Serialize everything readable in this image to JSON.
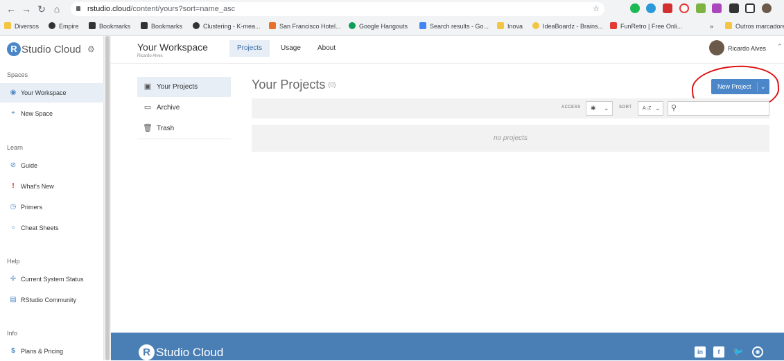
{
  "browser": {
    "url_host": "rstudio.cloud",
    "url_path": "/content/yours?sort=name_asc",
    "bookmarks": [
      {
        "label": "Diversos",
        "color": "#f4c542"
      },
      {
        "label": "Empire",
        "color": "#333333"
      },
      {
        "label": "Bookmarks",
        "color": "#333333"
      },
      {
        "label": "Bookmarks",
        "color": "#333333"
      },
      {
        "label": "Clustering - K-mea...",
        "color": "#333333"
      },
      {
        "label": "San Francisco Hotel...",
        "color": "#e8702a"
      },
      {
        "label": "Google Hangouts",
        "color": "#0f9d58"
      },
      {
        "label": "Search results - Go...",
        "color": "#4285f4"
      },
      {
        "label": "Inova",
        "color": "#f4c542"
      },
      {
        "label": "IdeaBoardz - Brains...",
        "color": "#f4c542"
      },
      {
        "label": "FunRetro | Free Onli...",
        "color": "#e53935"
      },
      {
        "label": "»",
        "color": ""
      },
      {
        "label": "Outros marcadores",
        "color": "#f4c542"
      }
    ]
  },
  "sidebar": {
    "logo_text": "Studio Cloud",
    "logo_letter": "R",
    "sections": {
      "spaces": "Spaces",
      "learn": "Learn",
      "help": "Help",
      "info": "Info"
    },
    "spaces_items": [
      {
        "label": "Your Workspace",
        "icon": "workspace-icon"
      },
      {
        "label": "New Space",
        "icon": "plus-icon"
      }
    ],
    "learn_items": [
      {
        "label": "Guide",
        "icon": "compass-icon"
      },
      {
        "label": "What's New",
        "icon": "exclamation-icon"
      },
      {
        "label": "Primers",
        "icon": "stopwatch-icon"
      },
      {
        "label": "Cheat Sheets",
        "icon": "circle-icon"
      }
    ],
    "help_items": [
      {
        "label": "Current System Status",
        "icon": "status-icon"
      },
      {
        "label": "RStudio Community",
        "icon": "chat-icon"
      }
    ],
    "info_items": [
      {
        "label": "Plans & Pricing",
        "icon": "dollar-icon"
      }
    ]
  },
  "header": {
    "title": "Your Workspace",
    "subtitle": "Ricardo Alves",
    "tabs": [
      "Projects",
      "Usage",
      "About"
    ],
    "user_name": "Ricardo Alves"
  },
  "content_nav": [
    {
      "label": "Your Projects",
      "icon": "projects-icon"
    },
    {
      "label": "Archive",
      "icon": "archive-icon"
    },
    {
      "label": "Trash",
      "icon": "trash-icon"
    }
  ],
  "projects": {
    "title": "Your Projects",
    "count": "(0)",
    "new_button": "New Project",
    "access_label": "ACCESS",
    "access_value": "✱",
    "sort_label": "SORT",
    "sort_value": "A↓Z",
    "empty_text": "no projects"
  },
  "footer": {
    "logo_text": "Studio Cloud",
    "logo_letter": "R",
    "social_icons": [
      "linkedin-icon",
      "facebook-icon",
      "twitter-icon",
      "github-icon"
    ]
  },
  "colors": {
    "brand_blue": "#4a86c8",
    "footer_blue": "#4a7fb5",
    "active_bg": "#e7eef6",
    "annotation_red": "#dd1111"
  }
}
